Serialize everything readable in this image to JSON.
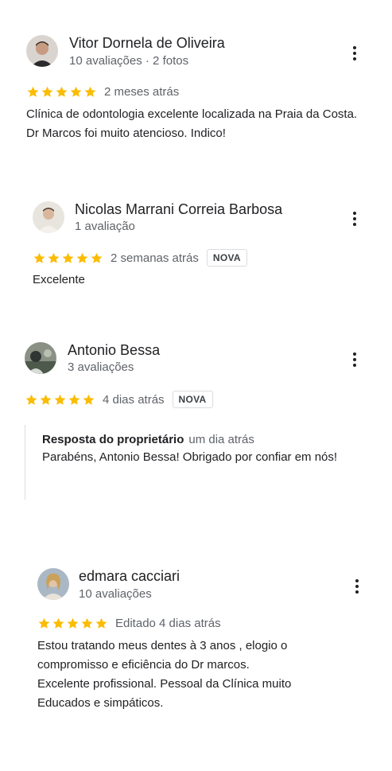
{
  "colors": {
    "star": "#fbbc04",
    "text": "#202124",
    "secondary": "#5f6368"
  },
  "reviews": [
    {
      "author": "Vitor Dornela de Oliveira",
      "meta": "10 avaliações · 2 fotos",
      "rating": 5,
      "date": "2 meses atrás",
      "text": "Clínica de odontologia excelente localizada na Praia da Costa. Dr Marcos foi muito atencioso. Indico!"
    },
    {
      "author": "Nicolas Marrani Correia Barbosa",
      "meta": "1 avaliação",
      "rating": 5,
      "date": "2 semanas atrás",
      "badge": "NOVA",
      "text": "Excelente"
    },
    {
      "author": "Antonio Bessa",
      "meta": "3 avaliações",
      "rating": 5,
      "date": "4 dias atrás",
      "badge": "NOVA",
      "reply": {
        "title": "Resposta do proprietário",
        "date": "um dia atrás",
        "text": "Parabéns, Antonio Bessa! Obrigado por confiar em nós!"
      }
    },
    {
      "author": "edmara cacciari",
      "meta": "10 avaliações",
      "rating": 5,
      "date": "Editado 4 dias atrás",
      "text_lines": [
        "Estou tratando meus dentes à 3 anos , elogio o",
        "compromisso e eficiência do Dr marcos.",
        "Excelente profissional. Pessoal da Clínica  muito",
        "Educados e simpáticos."
      ]
    }
  ]
}
